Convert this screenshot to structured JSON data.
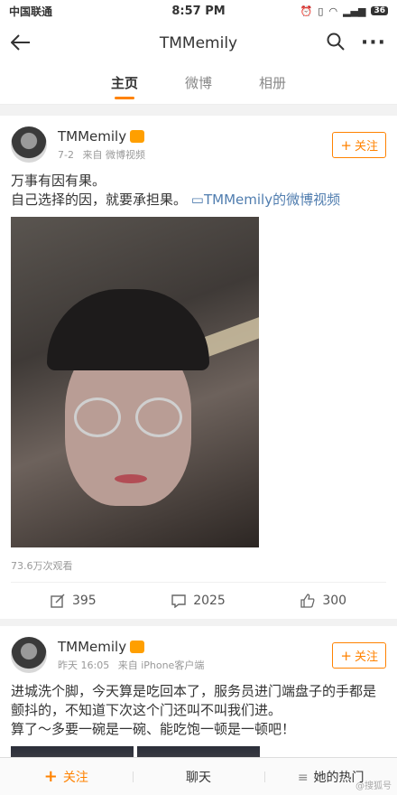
{
  "status_bar": {
    "carrier": "中国联通",
    "time": "8:57 PM",
    "battery": "36"
  },
  "nav": {
    "title": "TMMemily",
    "back_icon": "arrow-left-icon",
    "search_icon": "search-icon",
    "more_icon": "more-icon"
  },
  "tabs": [
    {
      "label": "主页",
      "active": true
    },
    {
      "label": "微博",
      "active": false
    },
    {
      "label": "相册",
      "active": false
    }
  ],
  "posts": [
    {
      "author": "TMMemily",
      "date": "7-2",
      "source": "来自 微博视频",
      "follow_label": "关注",
      "text_line1": "万事有因有果。",
      "text_line2": "自己选择的因，就要承担果。",
      "link_text": "TMMemily的微博视频",
      "views": "73.6万次观看",
      "reposts": "395",
      "comments": "2025",
      "likes": "300"
    },
    {
      "author": "TMMemily",
      "date": "昨天 16:05",
      "source": "来自 iPhone客户端",
      "follow_label": "关注",
      "text": "进城洗个脚，今天算是吃回本了，服务员进门端盘子的手都是颤抖的，不知道下次这个门还叫不叫我们进。",
      "text2": "算了～多要一碗是一碗、能吃饱一顿是一顿吧！"
    }
  ],
  "bottom_bar": {
    "follow": "关注",
    "chat": "聊天",
    "hot": "她的热门"
  },
  "watermark": "@搜狐号"
}
